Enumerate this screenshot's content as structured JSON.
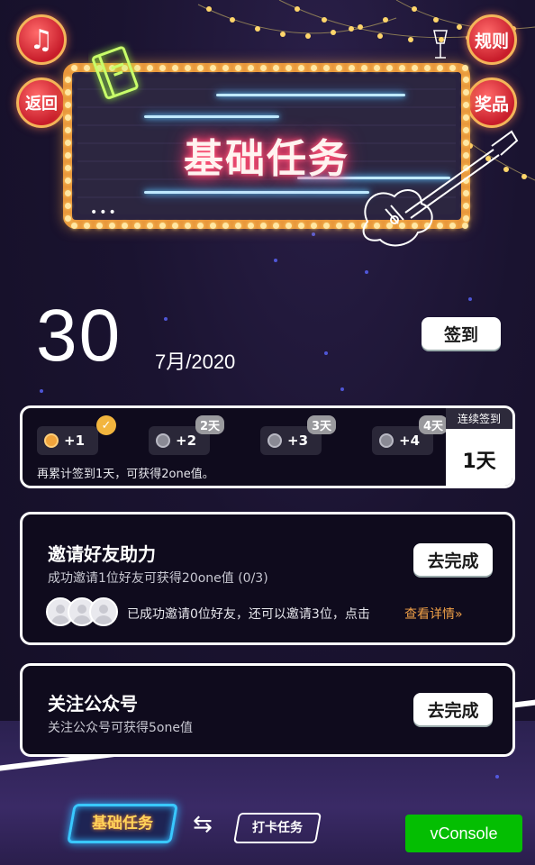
{
  "header": {
    "music_label": "♫",
    "back_label": "返回",
    "rules_label": "规则",
    "prizes_label": "奖品",
    "sign_title": "基础任务"
  },
  "date": {
    "day": "30",
    "month_year": "7月/2020",
    "signin_button": "签到"
  },
  "signin_card": {
    "items": [
      {
        "reward": "+1",
        "tag": "",
        "checked": true
      },
      {
        "reward": "+2",
        "tag": "2天",
        "checked": false
      },
      {
        "reward": "+3",
        "tag": "3天",
        "checked": false
      },
      {
        "reward": "+4",
        "tag": "4天",
        "checked": false
      }
    ],
    "note": "再累计签到1天，可获得2one值。",
    "streak_label": "连续签到",
    "streak_value": "1天"
  },
  "invite_card": {
    "title": "邀请好友助力",
    "subtitle": "成功邀请1位好友可获得20one值 (0/3)",
    "button": "去完成",
    "status_text": "已成功邀请0位好友，还可以邀请3位，点击",
    "detail_link": "查看详情»"
  },
  "follow_card": {
    "title": "关注公众号",
    "subtitle": "关注公众号可获得5one值",
    "button": "去完成"
  },
  "bottom": {
    "tab_basic": "基础任务",
    "swap_icon": "⇆",
    "tab_checkin": "打卡任务",
    "vconsole": "vConsole"
  },
  "colors": {
    "marquee_frame": "#e9973b",
    "neon_pink": "#ff3b6b",
    "neon_blue": "#3aa8ff",
    "link_orange": "#f0a047",
    "vconsole_green": "#04be02"
  }
}
